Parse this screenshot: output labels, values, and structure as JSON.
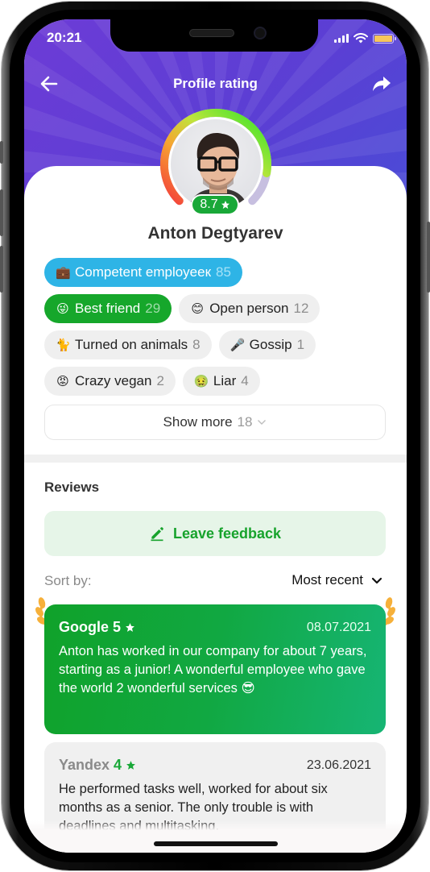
{
  "status_bar": {
    "time": "20:21",
    "icons": [
      "signal-icon",
      "wifi-icon",
      "battery-icon"
    ]
  },
  "header": {
    "back_icon": "arrow-left-icon",
    "title": "Profile rating",
    "share_icon": "share-arrow-icon"
  },
  "profile": {
    "name": "Anton Degtyarev",
    "rating": "8.7",
    "rating_icon": "star-icon",
    "rating_fraction": 0.87
  },
  "traits": [
    {
      "emoji": "💼",
      "icon": "briefcase-icon",
      "label": "Competent employeeк",
      "count": "85",
      "style": "blue"
    },
    {
      "emoji": "😜",
      "icon": "winking-tongue-face-icon",
      "label": "Best friend",
      "count": "29",
      "style": "green"
    },
    {
      "emoji": "😊",
      "icon": "smiling-face-icon",
      "label": "Open person",
      "count": "12",
      "style": "grey"
    },
    {
      "emoji": "🐈",
      "icon": "cat-icon",
      "label": "Turned on animals",
      "count": "8",
      "style": "grey"
    },
    {
      "emoji": "🎤",
      "icon": "microphone-icon",
      "label": "Gossip",
      "count": "1",
      "style": "grey"
    },
    {
      "emoji": "😡",
      "icon": "angry-face-icon",
      "label": "Crazy vegan",
      "count": "2",
      "style": "grey"
    },
    {
      "emoji": "🤢",
      "icon": "nauseated-face-icon",
      "label": "Liar",
      "count": "4",
      "style": "grey"
    }
  ],
  "show_more": {
    "label": "Show more",
    "count": "18",
    "icon": "chevron-down-icon"
  },
  "reviews": {
    "title": "Reviews",
    "leave_feedback_label": "Leave feedback",
    "leave_feedback_icon": "pencil-icon",
    "sort_label": "Sort by:",
    "sort_value": "Most recent",
    "items": [
      {
        "company": "Google",
        "score": "5",
        "date": "08.07.2021",
        "text": "Anton has worked in our company for about 7 years, starting as a junior! A wonderful employee who gave the world 2 wonderful services 😎",
        "featured": true
      },
      {
        "company": "Yandex",
        "score": "4",
        "date": "23.06.2021",
        "text": "He performed tasks well, worked for about six months as a senior. The only trouble is with deadlines and multitasking.",
        "featured": false
      }
    ]
  },
  "colors": {
    "header_purple": "#6d3bd6",
    "accent_green": "#19a838",
    "chip_blue": "#2eb4e6",
    "feedback_bg": "#e6f5e8",
    "laurel": "#f6b03a"
  }
}
